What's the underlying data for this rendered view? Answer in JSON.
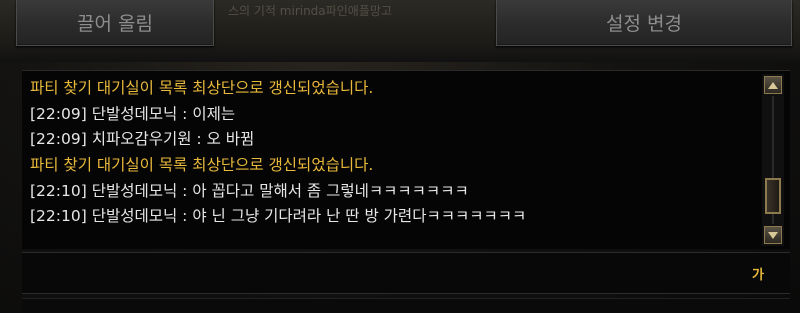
{
  "tabs": {
    "left_label": "끌어 올림",
    "right_label": "설정 변경"
  },
  "world_overlay_text": "스의 기적 mirinda파인애플망고",
  "chat": {
    "lines": [
      {
        "type": "system",
        "text": "파티 찾기 대기실이 목록 최상단으로 갱신되었습니다."
      },
      {
        "type": "player",
        "text": "[22:09] 단발성데모닉 : 이제는"
      },
      {
        "type": "player",
        "text": "[22:09] 치파오감우기원 : 오 바뀜"
      },
      {
        "type": "system",
        "text": "파티 찾기 대기실이 목록 최상단으로 갱신되었습니다."
      },
      {
        "type": "player",
        "text": "[22:10] 단발성데모닉 : 아 꼽다고 말해서 좀 그렇네ㅋㅋㅋㅋㅋㅋㅋ"
      },
      {
        "type": "player",
        "text": "[22:10] 단발성데모닉 : 야  닌 그냥 기다려라 난 딴 방 가련다ㅋㅋㅋㅋㅋㅋㅋ"
      }
    ]
  },
  "input": {
    "value": "",
    "ime_mode_label": "가"
  },
  "colors": {
    "system_message": "#e8b93a",
    "player_message": "#e6e6e6",
    "scroll_accent": "#8c7a4e"
  },
  "icons": {
    "scroll_up": "triangle-up-icon",
    "scroll_down": "triangle-down-icon"
  }
}
